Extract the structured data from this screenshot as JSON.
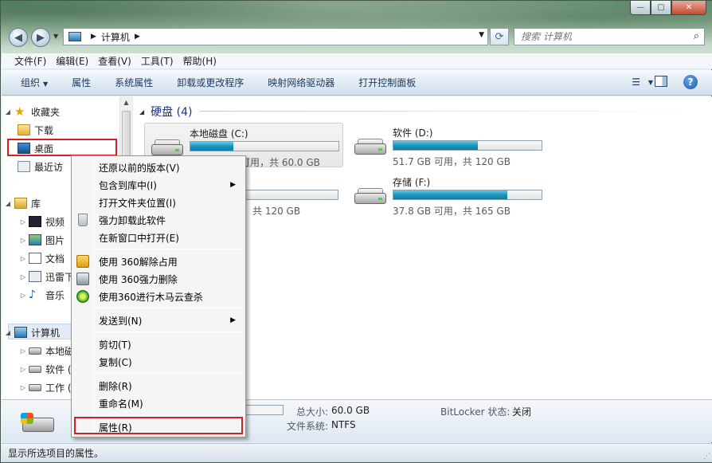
{
  "window": {
    "min_label": "—",
    "max_label": "▢",
    "close_label": "✕"
  },
  "address": {
    "path": "计算机",
    "search_placeholder": "搜索 计算机"
  },
  "menubar": [
    "文件(F)",
    "编辑(E)",
    "查看(V)",
    "工具(T)",
    "帮助(H)"
  ],
  "toolbar": {
    "organize": "组织",
    "properties": "属性",
    "system_properties": "系统属性",
    "uninstall": "卸载或更改程序",
    "map_drive": "映射网络驱动器",
    "control_panel": "打开控制面板"
  },
  "nav": {
    "favorites": "收藏夹",
    "downloads": "下载",
    "desktop": "桌面",
    "recent": "最近访",
    "libraries": "库",
    "videos": "视频",
    "pictures": "图片",
    "documents": "文档",
    "thunder": "迅雷下",
    "music": "音乐",
    "computer": "计算机",
    "local_disk": "本地磁",
    "software": "软件 (",
    "work": "工作 ("
  },
  "content": {
    "group_title": "硬盘 (4)",
    "drives": [
      {
        "name": "本地磁盘 (C:)",
        "free": "可用，共 60.0 GB",
        "fill": 0.29
      },
      {
        "name": "软件 (D:)",
        "free": "51.7 GB 可用，共 120 GB",
        "fill": 0.57
      },
      {
        "name": "",
        "free": "，共 120 GB",
        "fill": 0.0
      },
      {
        "name": "存储 (F:)",
        "free": "37.8 GB 可用，共 165 GB",
        "fill": 0.77
      }
    ]
  },
  "details": {
    "total_label": "总大小:",
    "total_value": "60.0 GB",
    "fs_label": "文件系统:",
    "fs_value": "NTFS",
    "bitlocker_label": "BitLocker 状态:",
    "bitlocker_value": "关闭"
  },
  "status": "显示所选项目的属性。",
  "context_menu": {
    "restore": "还原以前的版本(V)",
    "include_library": "包含到库中(I)",
    "open_location": "打开文件夹位置(I)",
    "force_uninstall": "强力卸载此软件",
    "open_new_window": "在新窗口中打开(E)",
    "unlock_360": "使用 360解除占用",
    "shred_360": "使用 360强力删除",
    "scan_360": "使用360进行木马云查杀",
    "send_to": "发送到(N)",
    "cut": "剪切(T)",
    "copy": "复制(C)",
    "delete": "删除(R)",
    "rename": "重命名(M)",
    "properties": "属性(R)"
  }
}
